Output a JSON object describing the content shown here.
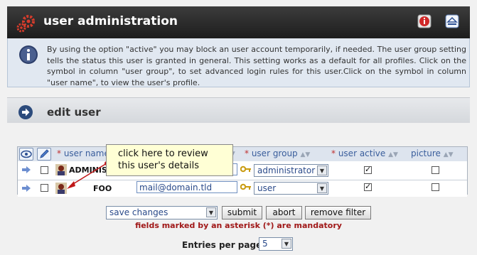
{
  "header": {
    "title": "user administration",
    "help_icon": "help-icon",
    "collapse_icon": "collapse-up-icon"
  },
  "info": {
    "text": "By using the option \"active\" you may block an user account temporarily, if needed. The user group setting tells the status this user is granted in general. This setting works as a default for all profiles. Click on the symbol in column \"user group\", to set advanced login rules for this user.Click on the symbol in column \"user name\", to view the user's profile."
  },
  "section": {
    "title": "edit user"
  },
  "table": {
    "columns": {
      "user_name": "user name",
      "user_group": "user group",
      "user_active": "user active",
      "picture": "picture",
      "asterisk": "*"
    },
    "rows": [
      {
        "username": "ADMINIST",
        "email": "",
        "group": "administrator",
        "active": true,
        "picture": false,
        "selected": false
      },
      {
        "username": "FOO",
        "email": "mail@domain.tld",
        "group": "user",
        "active": true,
        "picture": false,
        "selected": false
      }
    ]
  },
  "tooltip": {
    "line1": "click here to review",
    "line2": "this user's details"
  },
  "actions": {
    "action_select": "save changes",
    "submit": "submit",
    "abort": "abort",
    "remove_filter": "remove filter",
    "mandatory_note": "fields marked by an asterisk (*) are mandatory"
  },
  "paging": {
    "label": "Entries per page",
    "value": "5"
  },
  "colors": {
    "header_bg": "#2b2b2b",
    "info_bg": "#e1e8f1",
    "link_blue": "#3a5e9c",
    "mandatory_red": "#a01818"
  }
}
